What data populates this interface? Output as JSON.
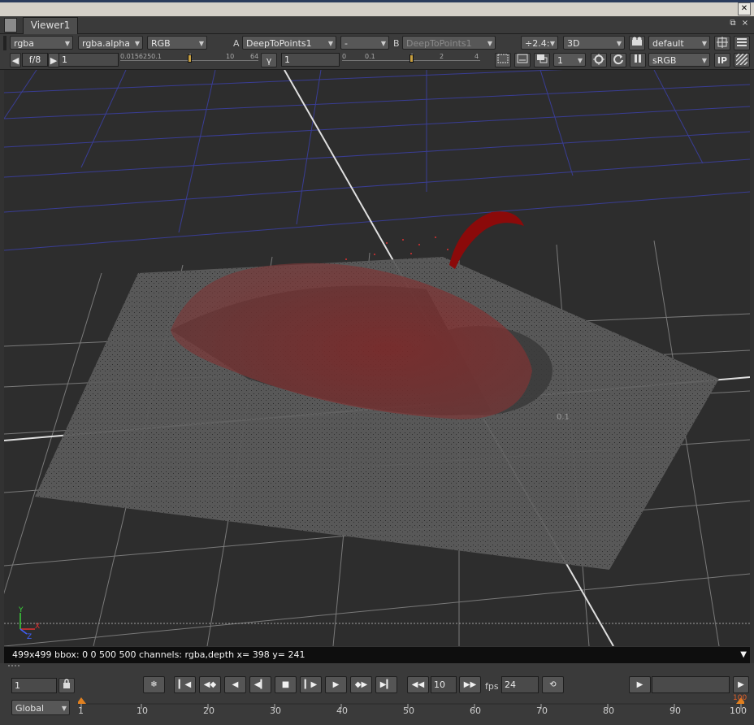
{
  "window": {
    "close_glyph": "✕"
  },
  "tab": {
    "label": "Viewer1"
  },
  "row1": {
    "channels": "rgba",
    "layer": "rgba.alpha",
    "display": "RGB",
    "a_label": "A",
    "input_a": "DeepToPoints1",
    "op": "-",
    "b_label": "B",
    "input_b": "DeepToPoints1",
    "downrez": "÷2.4:",
    "view_mode": "3D",
    "camera": "default"
  },
  "row2": {
    "fstop": "f/8",
    "gain": "1",
    "gain_ticks": [
      "0.0156250.1",
      "1",
      "10",
      "64"
    ],
    "gamma_label": "γ",
    "gamma": "1",
    "gamma_ticks": [
      "0",
      "0.1",
      "1",
      "2",
      "4"
    ],
    "proxy": "1",
    "lut": "sRGB",
    "ip_label": "IP"
  },
  "viewport": {
    "axis_y": "Y",
    "axis_x": "X",
    "axis_z": "Z",
    "grid_label": "0.1",
    "surface_color": "#575757",
    "blob_color": "#7a2b2b",
    "bg_color": "#2d2d2d"
  },
  "status": {
    "text": "499x499 bbox: 0 0 500 500 channels: rgba,depth  x= 398 y= 241"
  },
  "timeline": {
    "frame": "1",
    "increment": "10",
    "fps_label": "fps",
    "fps": "24",
    "range_mode": "Global",
    "ruler_labels": [
      "1",
      "10",
      "20",
      "30",
      "40",
      "50",
      "60",
      "70",
      "80",
      "90",
      "100"
    ],
    "end_marker": "100"
  }
}
